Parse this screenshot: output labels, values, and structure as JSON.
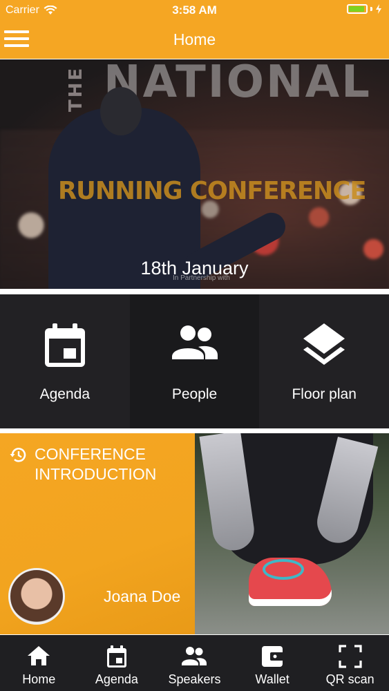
{
  "status_bar": {
    "carrier": "Carrier",
    "time": "3:58 AM",
    "battery_color": "#7ed321"
  },
  "header": {
    "title": "Home",
    "menu_icon": "hamburger-icon",
    "background": "#F5A623"
  },
  "hero": {
    "title_the": "THE",
    "title_national": "NATIONAL",
    "title_running": "RUNNING CONFERENCE",
    "date": "18th January",
    "partnership": "In Partnership with"
  },
  "tiles": [
    {
      "label": "Agenda",
      "icon": "calendar-icon"
    },
    {
      "label": "People",
      "icon": "people-icon"
    },
    {
      "label": "Floor plan",
      "icon": "layers-icon"
    }
  ],
  "feature": {
    "icon": "history-icon",
    "title_line1": "CONFERENCE",
    "title_line2": "INTRODUCTION",
    "speaker_name": "Joana Doe"
  },
  "tabbar": [
    {
      "label": "Home",
      "icon": "home-icon"
    },
    {
      "label": "Agenda",
      "icon": "calendar-icon"
    },
    {
      "label": "Speakers",
      "icon": "people-icon"
    },
    {
      "label": "Wallet",
      "icon": "wallet-icon"
    },
    {
      "label": "QR scan",
      "icon": "qr-scan-icon"
    }
  ]
}
